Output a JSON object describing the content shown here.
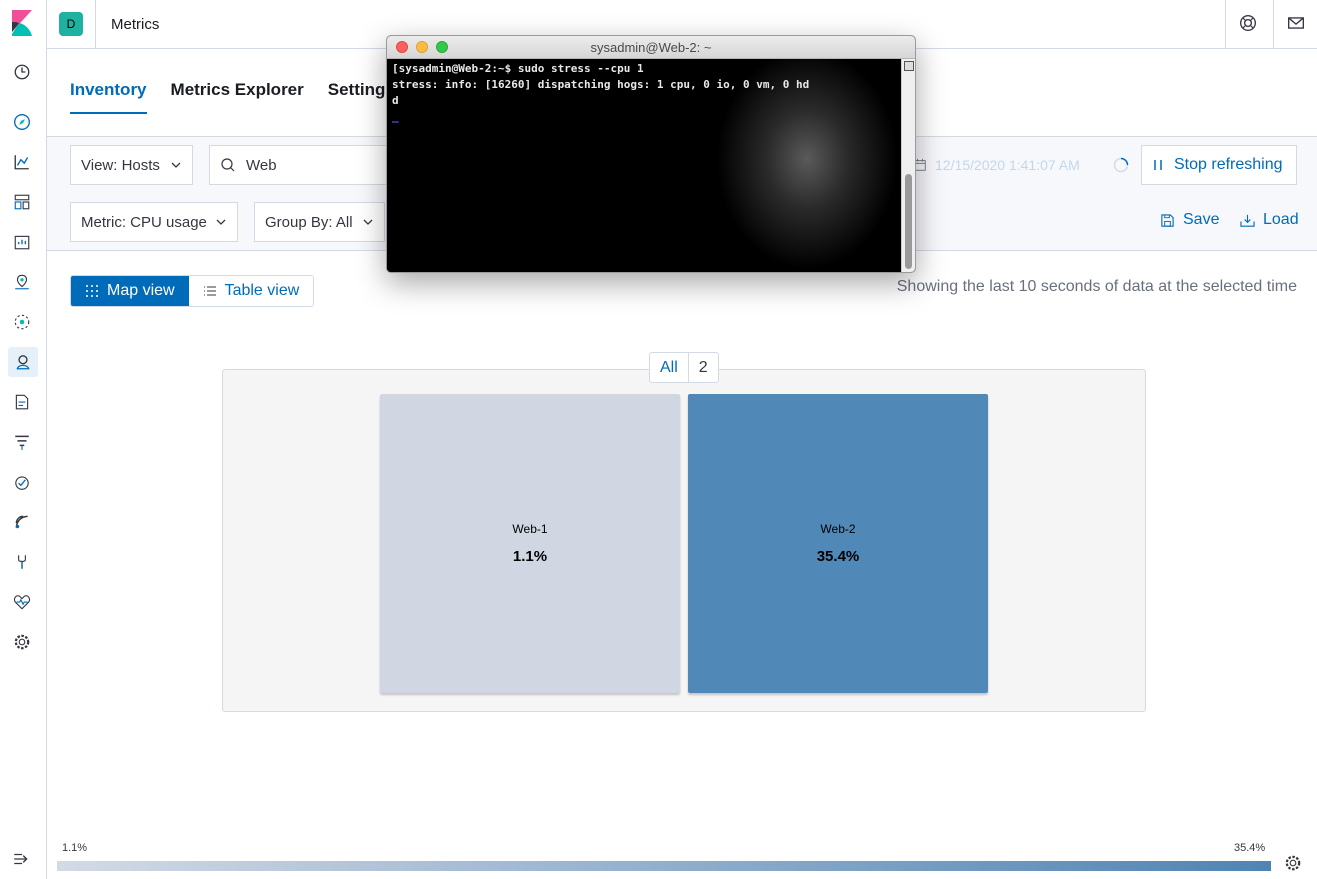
{
  "header": {
    "space_initial": "D",
    "app_title": "Metrics"
  },
  "tabs": [
    {
      "label": "Inventory"
    },
    {
      "label": "Metrics Explorer"
    },
    {
      "label": "Settings"
    }
  ],
  "toolbar": {
    "view_select": "View: Hosts",
    "search_value": "Web",
    "date_value": "12/15/2020 1:41:07 AM",
    "refresh_label": "Stop refreshing",
    "metric_select": "Metric: CPU usage",
    "group_by_select": "Group By: All",
    "save_label": "Save",
    "load_label": "Load"
  },
  "view_toggle": {
    "map_label": "Map view",
    "table_label": "Table view"
  },
  "showing_text": "Showing the last 10 seconds of data at the selected time",
  "map": {
    "group_name": "All",
    "group_count": "2",
    "nodes": [
      {
        "name": "Web-1",
        "value": "1.1%",
        "color": "#d0d7e3"
      },
      {
        "name": "Web-2",
        "value": "35.4%",
        "color": "#5088b7"
      }
    ]
  },
  "legend": {
    "min": "1.1%",
    "max": "35.4%",
    "color_start": "#d3dae6",
    "color_end": "#5084b3"
  },
  "terminal": {
    "title": "sysadmin@Web-2: ~",
    "line1": "[sysadmin@Web-2:~$ sudo stress --cpu 1",
    "line2": "stress: info: [16260] dispatching hogs: 1 cpu, 0 io, 0 vm, 0 hd",
    "line3": "d",
    "cursor": "_"
  }
}
